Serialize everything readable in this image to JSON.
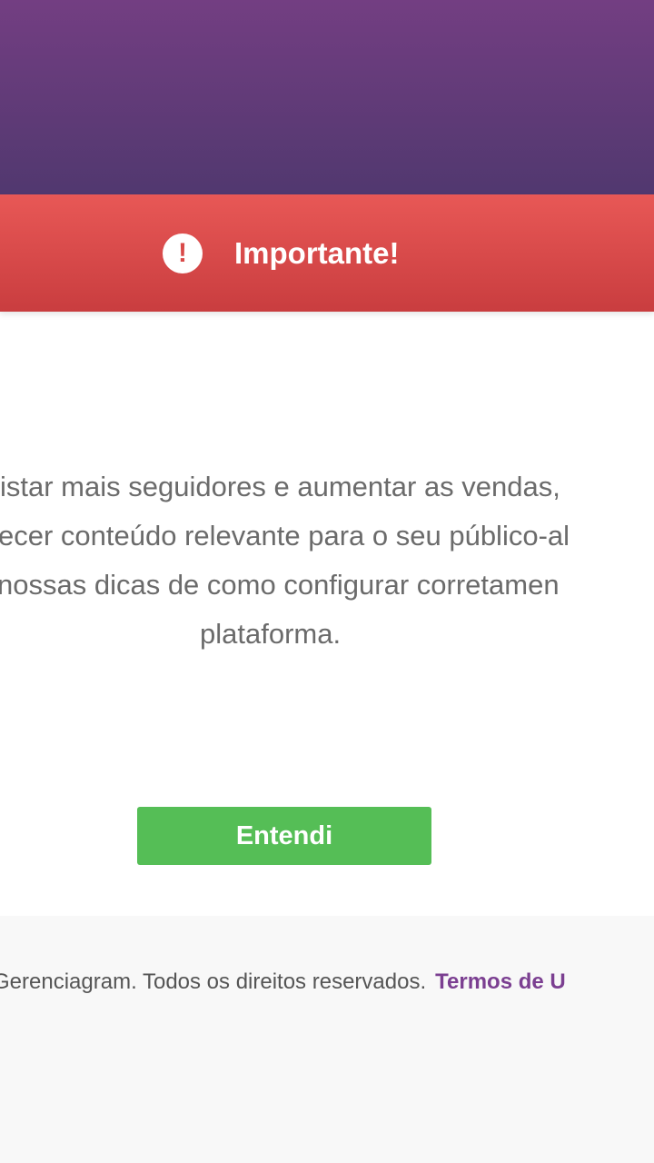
{
  "alert": {
    "icon": "exclamation-circle-icon",
    "icon_glyph": "!",
    "title": "Importante!"
  },
  "message": {
    "lines": [
      "istar mais seguidores e aumentar as vendas,",
      "ecer conteúdo relevante para o seu público-al",
      "nossas dicas de como configurar corretamen",
      "plataforma."
    ]
  },
  "actions": {
    "confirm_label": "Entendi"
  },
  "footer": {
    "copyright": "Gerenciagram. Todos os direitos reservados.",
    "terms_link": "Termos de U"
  },
  "colors": {
    "header_top": "#733e82",
    "header_bottom": "#51386f",
    "alert_red": "#e05150",
    "button_green": "#55be56",
    "link_purple": "#7b3f91"
  }
}
